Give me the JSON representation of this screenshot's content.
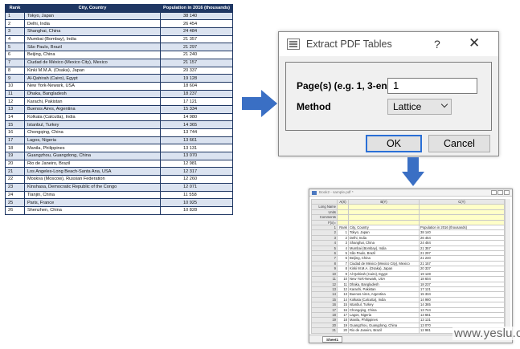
{
  "pdf_table": {
    "headers": [
      "Rank",
      "City, Country",
      "Population in 2016 (thousands)"
    ],
    "rows": [
      [
        "1",
        "Tokyo, Japan",
        "38 140"
      ],
      [
        "2",
        "Delhi, India",
        "26 454"
      ],
      [
        "3",
        "Shanghai, China",
        "24 484"
      ],
      [
        "4",
        "Mumbai (Bombay), India",
        "21 357"
      ],
      [
        "5",
        "São Paulo, Brazil",
        "21 297"
      ],
      [
        "6",
        "Beijing, China",
        "21 240"
      ],
      [
        "7",
        "Ciudad de México (Mexico City), Mexico",
        "21 157"
      ],
      [
        "8",
        "Kinki M.M.A. (Osaka), Japan",
        "20 337"
      ],
      [
        "9",
        "Al-Qahirah (Cairo), Egypt",
        "19 128"
      ],
      [
        "10",
        "New York-Newark, USA",
        "18 604"
      ],
      [
        "11",
        "Dhaka, Bangladesh",
        "18 237"
      ],
      [
        "12",
        "Karachi, Pakistan",
        "17 121"
      ],
      [
        "13",
        "Buenos Aires, Argentina",
        "15 334"
      ],
      [
        "14",
        "Kolkata (Calcutta), India",
        "14 980"
      ],
      [
        "15",
        "Istanbul, Turkey",
        "14 365"
      ],
      [
        "16",
        "Chongqing, China",
        "13 744"
      ],
      [
        "17",
        "Lagos, Nigeria",
        "13 661"
      ],
      [
        "18",
        "Manila, Philippines",
        "13 131"
      ],
      [
        "19",
        "Guangzhou, Guangdong, China",
        "13 070"
      ],
      [
        "20",
        "Rio de Janeiro, Brazil",
        "12 981"
      ],
      [
        "21",
        "Los Angeles-Long Beach-Santa Ana, USA",
        "12 317"
      ],
      [
        "22",
        "Moskva (Moscow), Russian Federation",
        "12 260"
      ],
      [
        "23",
        "Kinshasa, Democratic Republic of the Congo",
        "12 071"
      ],
      [
        "24",
        "Tianjin, China",
        "11 558"
      ],
      [
        "25",
        "Paris, France",
        "10 925"
      ],
      [
        "26",
        "Shenzhen, China",
        "10 828"
      ]
    ]
  },
  "dialog": {
    "title": "Extract PDF Tables",
    "help_glyph": "?",
    "close_glyph": "✕",
    "pages_label": "Page(s) (e.g. 1, 3-end)",
    "pages_value": "1",
    "method_label": "Method",
    "method_value": "Lattice",
    "ok_label": "OK",
    "cancel_label": "Cancel"
  },
  "worksheet": {
    "window_title": "Book2 - sample.pdf *",
    "columns": [
      "A(X)",
      "B(Y)",
      "C(Y)"
    ],
    "meta_rows": [
      "Long Name",
      "Units",
      "Comments",
      "F(x)="
    ],
    "header_row": [
      "Rank",
      "City, Country",
      "Population in 2016 (thousands)"
    ],
    "rows": [
      [
        "1",
        "Tokyo, Japan",
        "38 140"
      ],
      [
        "2",
        "Delhi, India",
        "26 454"
      ],
      [
        "3",
        "Shanghai, China",
        "24 484"
      ],
      [
        "4",
        "Mumbai (Bombay), India",
        "21 357"
      ],
      [
        "5",
        "São Paulo, Brazil",
        "21 297"
      ],
      [
        "6",
        "Beijing, China",
        "21 240"
      ],
      [
        "7",
        "Ciudad de México (Mexico City), Mexico",
        "21 157"
      ],
      [
        "8",
        "Kinki M.M.A. (Osaka), Japan",
        "20 337"
      ],
      [
        "9",
        "Al-Qahirah (Cairo), Egypt",
        "19 128"
      ],
      [
        "10",
        "New York-Newark, USA",
        "18 604"
      ],
      [
        "11",
        "Dhaka, Bangladesh",
        "18 237"
      ],
      [
        "12",
        "Karachi, Pakistan",
        "17 121"
      ],
      [
        "13",
        "Buenos Aires, Argentina",
        "15 334"
      ],
      [
        "14",
        "Kolkata (Calcutta), India",
        "14 980"
      ],
      [
        "15",
        "Istanbul, Turkey",
        "14 365"
      ],
      [
        "16",
        "Chongqing, China",
        "13 744"
      ],
      [
        "17",
        "Lagos, Nigeria",
        "13 661"
      ],
      [
        "18",
        "Manila, Philippines",
        "13 131"
      ],
      [
        "19",
        "Guangzhou, Guangdong, China",
        "13 070"
      ],
      [
        "20",
        "Rio de Janeiro, Brazil",
        "12 981"
      ]
    ],
    "sheet_tab": "Sheet1"
  },
  "watermark": "www.yeslu.cn",
  "colors": {
    "table_header": "#1f3763",
    "table_band": "#dbe3f0",
    "arrow": "#3a6fc4",
    "ok_focus": "#2a6fd6"
  }
}
